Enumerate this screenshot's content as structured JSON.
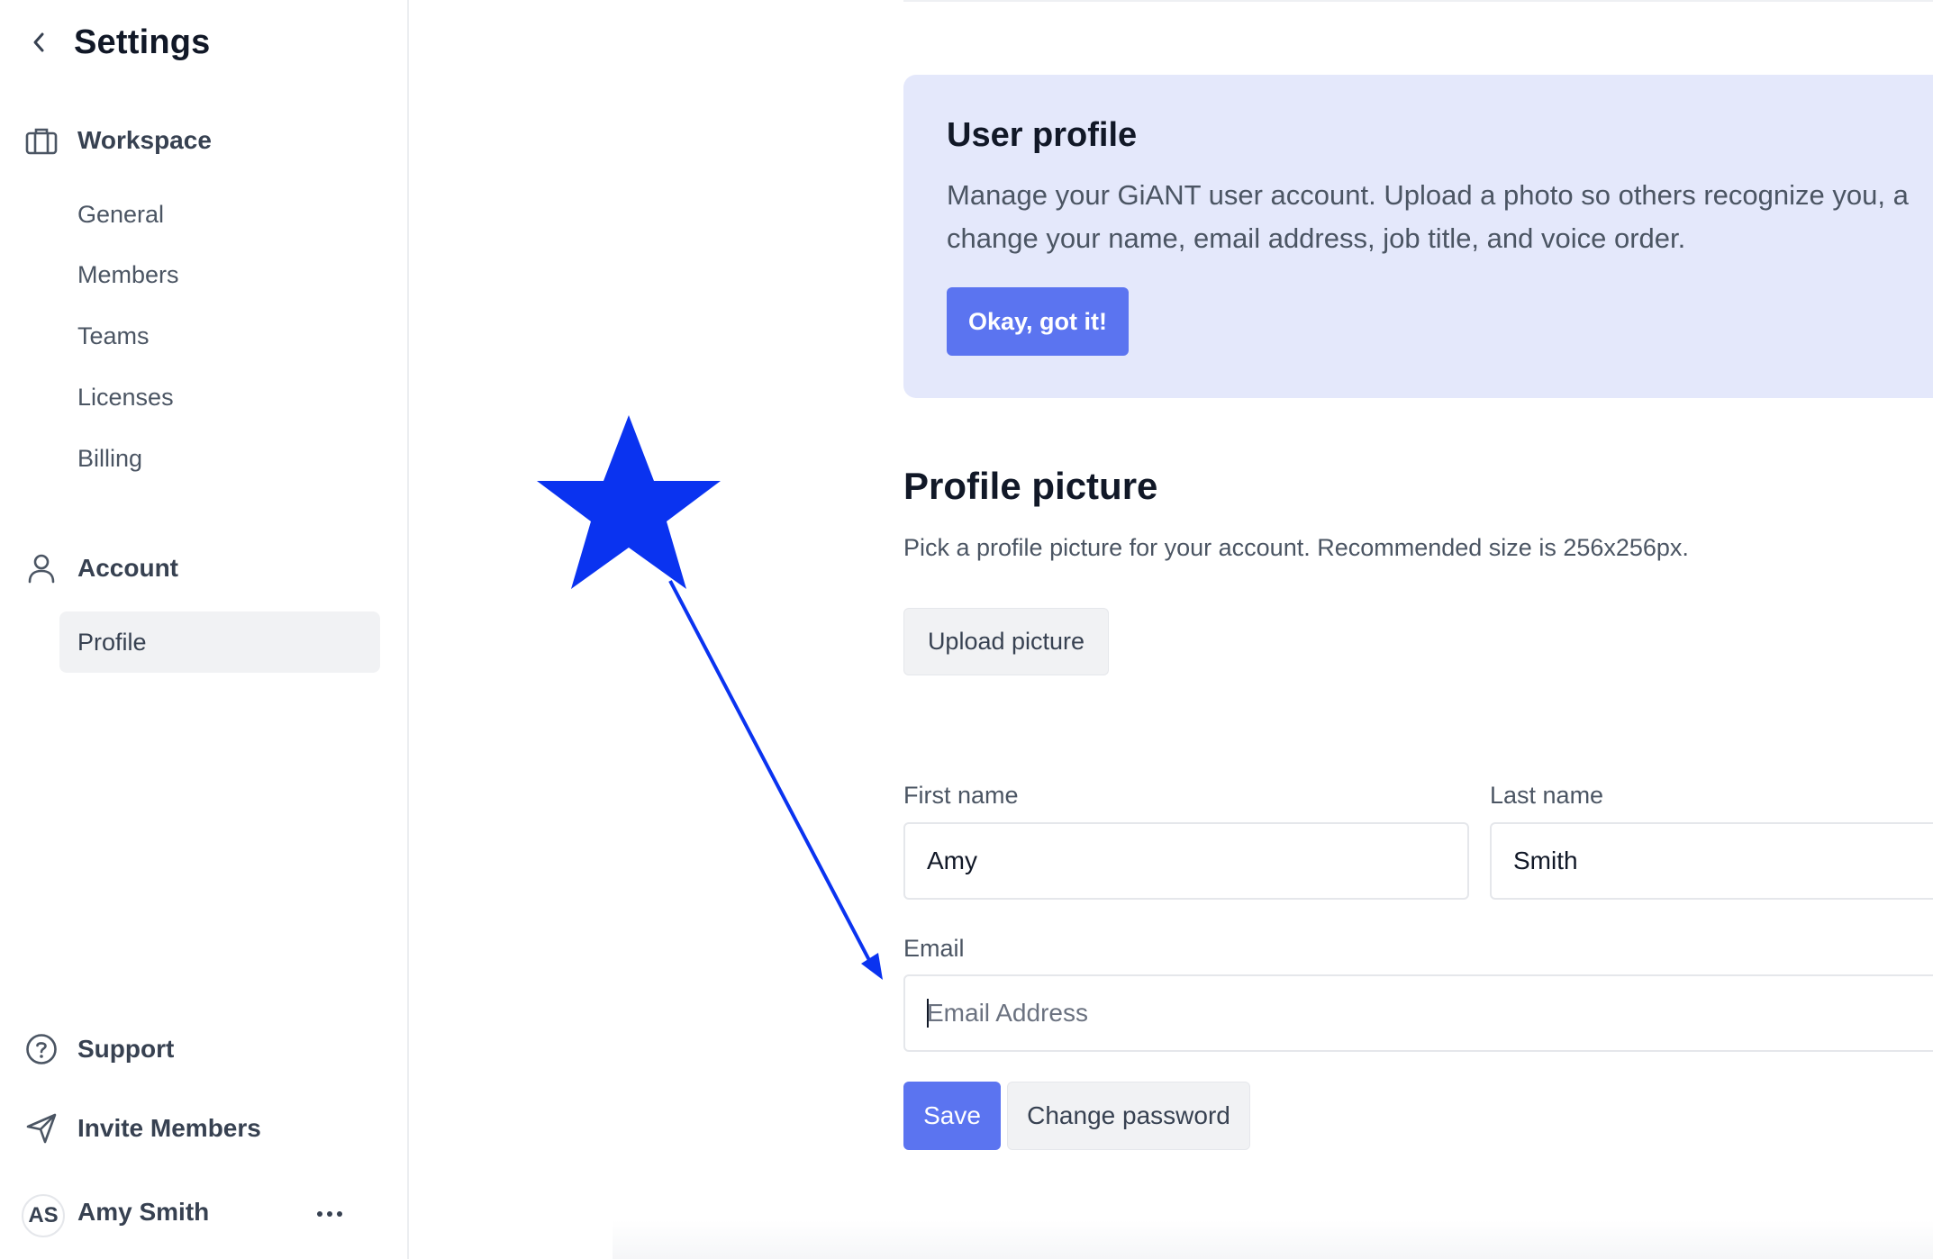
{
  "sidebar": {
    "title": "Settings",
    "workspace_label": "Workspace",
    "workspace_items": [
      "General",
      "Members",
      "Teams",
      "Licenses",
      "Billing"
    ],
    "account_label": "Account",
    "account_items": [
      "Profile"
    ],
    "support_label": "Support",
    "invite_label": "Invite Members",
    "user": {
      "initials": "AS",
      "name": "Amy Smith"
    },
    "icons": [
      "chevron-left-icon",
      "briefcase-icon",
      "user-icon",
      "help-circle-icon",
      "send-icon",
      "more-horizontal-icon"
    ]
  },
  "banner": {
    "title": "User profile",
    "text": "Manage your GiANT user account. Upload a photo so others recognize you, a change your name, email address, job title, and voice order.",
    "button_label": "Okay, got it!"
  },
  "profile_picture": {
    "title": "Profile picture",
    "help": "Pick a profile picture for your account. Recommended size is 256x256px.",
    "upload_label": "Upload picture"
  },
  "form": {
    "first_name_label": "First name",
    "first_name_value": "Amy",
    "last_name_label": "Last name",
    "last_name_value": "Smith",
    "email_label": "Email",
    "email_placeholder": "Email Address",
    "email_value": "",
    "save_label": "Save",
    "change_password_label": "Change password"
  },
  "colors": {
    "accent": "#5b74f0",
    "banner_bg": "#e4e8fb",
    "annotation": "#0a33f0"
  }
}
